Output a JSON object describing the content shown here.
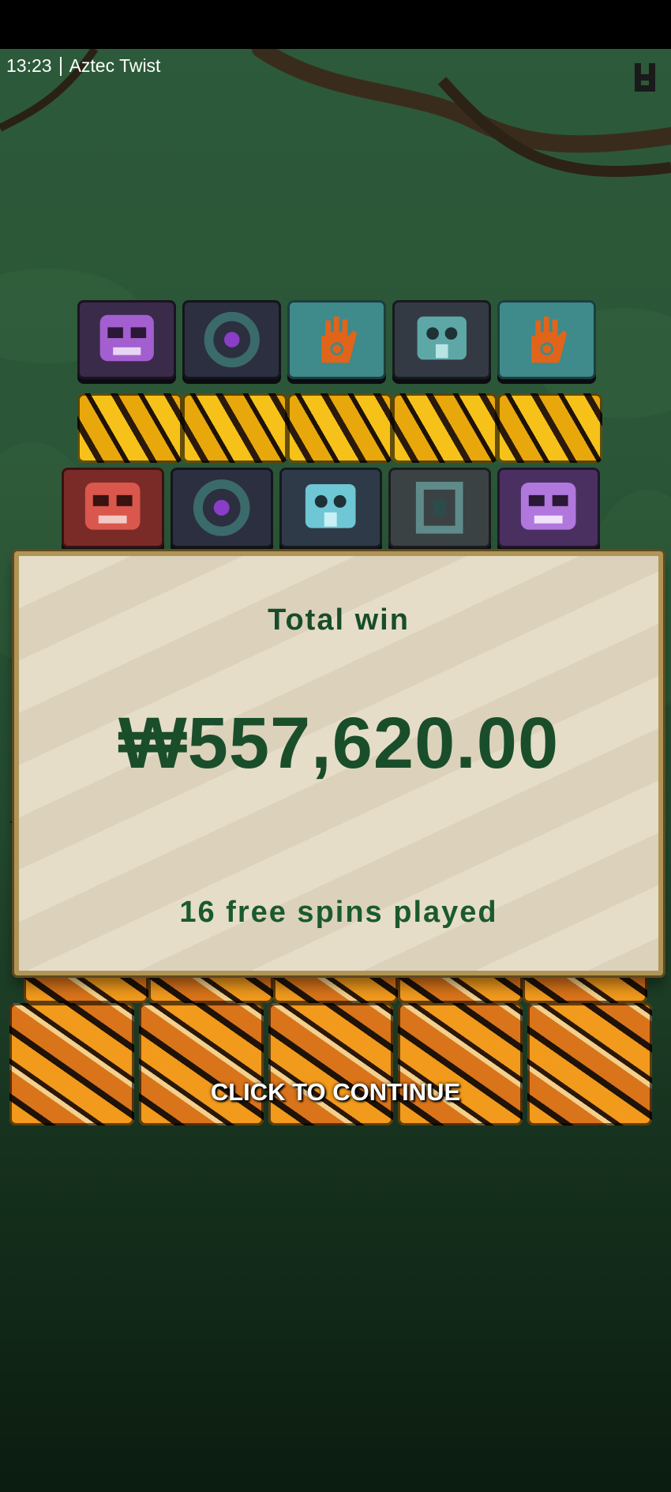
{
  "status": {
    "time": "13:23",
    "app_title": "Aztec Twist"
  },
  "win_dialog": {
    "title": "Total win",
    "amount": "₩557,620.00",
    "subtitle": "16 free spins played"
  },
  "continue_label": "CLICK TO CONTINUE",
  "grid": {
    "row1": [
      "purple-skull",
      "circle",
      "hand",
      "teal-mask",
      "hand"
    ],
    "row2": [
      "gold-pattern",
      "gold-pattern",
      "gold-pattern",
      "gold-pattern",
      "gold-pattern"
    ],
    "row3": [
      "red-skull",
      "circle",
      "teal-mask",
      "square",
      "purple-skull"
    ],
    "row5": [
      "orange-pattern",
      "orange-pattern",
      "orange-pattern",
      "orange-pattern",
      "orange-pattern"
    ]
  },
  "colors": {
    "background": "#2b5637",
    "panel_text": "#1a4e2b",
    "panel_border": "#b09556"
  }
}
